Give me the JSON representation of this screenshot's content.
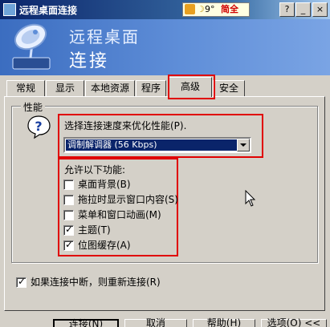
{
  "window": {
    "title": "远程桌面连接",
    "ime": {
      "icon": "ime-c-icon",
      "moon": "☽",
      "num": "9°",
      "mode": "简全"
    },
    "buttons": {
      "help": "?",
      "minimize": "_",
      "close": "×"
    }
  },
  "banner": {
    "line1": "远程桌面",
    "line2": "连接"
  },
  "tabs": [
    {
      "label": "常规"
    },
    {
      "label": "显示"
    },
    {
      "label": "本地资源"
    },
    {
      "label": "程序"
    },
    {
      "label": "高级"
    },
    {
      "label": "安全"
    }
  ],
  "active_tab": "高级",
  "performance": {
    "group_label": "性能",
    "prompt": "选择连接速度来优化性能(P).",
    "speed_select": {
      "value": "调制解调器 (56 Kbps)"
    },
    "allow_label": "允许以下功能:",
    "options": [
      {
        "label": "桌面背景(B)",
        "checked": false
      },
      {
        "label": "拖拉时显示窗口内容(S)",
        "checked": false
      },
      {
        "label": "菜单和窗口动画(M)",
        "checked": false
      },
      {
        "label": "主题(T)",
        "checked": true
      },
      {
        "label": "位图缓存(A)",
        "checked": true
      }
    ]
  },
  "reconnect": {
    "label": "如果连接中断，则重新连接(R)",
    "checked": true
  },
  "buttons": {
    "connect": "连接(N)",
    "cancel": "取消",
    "help": "帮助(H)",
    "options": "选项(O) <<"
  },
  "colors": {
    "annotation_red": "#e00000",
    "titlebar": "#0a246a",
    "selection": "#0a246a"
  }
}
